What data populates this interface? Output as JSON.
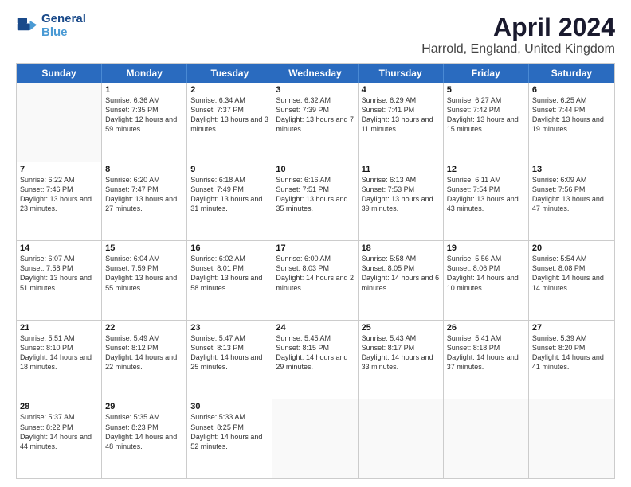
{
  "header": {
    "logo_line1": "General",
    "logo_line2": "Blue",
    "month": "April 2024",
    "location": "Harrold, England, United Kingdom"
  },
  "weekdays": [
    "Sunday",
    "Monday",
    "Tuesday",
    "Wednesday",
    "Thursday",
    "Friday",
    "Saturday"
  ],
  "weeks": [
    [
      {
        "day": "",
        "sunrise": "",
        "sunset": "",
        "daylight": ""
      },
      {
        "day": "1",
        "sunrise": "Sunrise: 6:36 AM",
        "sunset": "Sunset: 7:35 PM",
        "daylight": "Daylight: 12 hours and 59 minutes."
      },
      {
        "day": "2",
        "sunrise": "Sunrise: 6:34 AM",
        "sunset": "Sunset: 7:37 PM",
        "daylight": "Daylight: 13 hours and 3 minutes."
      },
      {
        "day": "3",
        "sunrise": "Sunrise: 6:32 AM",
        "sunset": "Sunset: 7:39 PM",
        "daylight": "Daylight: 13 hours and 7 minutes."
      },
      {
        "day": "4",
        "sunrise": "Sunrise: 6:29 AM",
        "sunset": "Sunset: 7:41 PM",
        "daylight": "Daylight: 13 hours and 11 minutes."
      },
      {
        "day": "5",
        "sunrise": "Sunrise: 6:27 AM",
        "sunset": "Sunset: 7:42 PM",
        "daylight": "Daylight: 13 hours and 15 minutes."
      },
      {
        "day": "6",
        "sunrise": "Sunrise: 6:25 AM",
        "sunset": "Sunset: 7:44 PM",
        "daylight": "Daylight: 13 hours and 19 minutes."
      }
    ],
    [
      {
        "day": "7",
        "sunrise": "Sunrise: 6:22 AM",
        "sunset": "Sunset: 7:46 PM",
        "daylight": "Daylight: 13 hours and 23 minutes."
      },
      {
        "day": "8",
        "sunrise": "Sunrise: 6:20 AM",
        "sunset": "Sunset: 7:47 PM",
        "daylight": "Daylight: 13 hours and 27 minutes."
      },
      {
        "day": "9",
        "sunrise": "Sunrise: 6:18 AM",
        "sunset": "Sunset: 7:49 PM",
        "daylight": "Daylight: 13 hours and 31 minutes."
      },
      {
        "day": "10",
        "sunrise": "Sunrise: 6:16 AM",
        "sunset": "Sunset: 7:51 PM",
        "daylight": "Daylight: 13 hours and 35 minutes."
      },
      {
        "day": "11",
        "sunrise": "Sunrise: 6:13 AM",
        "sunset": "Sunset: 7:53 PM",
        "daylight": "Daylight: 13 hours and 39 minutes."
      },
      {
        "day": "12",
        "sunrise": "Sunrise: 6:11 AM",
        "sunset": "Sunset: 7:54 PM",
        "daylight": "Daylight: 13 hours and 43 minutes."
      },
      {
        "day": "13",
        "sunrise": "Sunrise: 6:09 AM",
        "sunset": "Sunset: 7:56 PM",
        "daylight": "Daylight: 13 hours and 47 minutes."
      }
    ],
    [
      {
        "day": "14",
        "sunrise": "Sunrise: 6:07 AM",
        "sunset": "Sunset: 7:58 PM",
        "daylight": "Daylight: 13 hours and 51 minutes."
      },
      {
        "day": "15",
        "sunrise": "Sunrise: 6:04 AM",
        "sunset": "Sunset: 7:59 PM",
        "daylight": "Daylight: 13 hours and 55 minutes."
      },
      {
        "day": "16",
        "sunrise": "Sunrise: 6:02 AM",
        "sunset": "Sunset: 8:01 PM",
        "daylight": "Daylight: 13 hours and 58 minutes."
      },
      {
        "day": "17",
        "sunrise": "Sunrise: 6:00 AM",
        "sunset": "Sunset: 8:03 PM",
        "daylight": "Daylight: 14 hours and 2 minutes."
      },
      {
        "day": "18",
        "sunrise": "Sunrise: 5:58 AM",
        "sunset": "Sunset: 8:05 PM",
        "daylight": "Daylight: 14 hours and 6 minutes."
      },
      {
        "day": "19",
        "sunrise": "Sunrise: 5:56 AM",
        "sunset": "Sunset: 8:06 PM",
        "daylight": "Daylight: 14 hours and 10 minutes."
      },
      {
        "day": "20",
        "sunrise": "Sunrise: 5:54 AM",
        "sunset": "Sunset: 8:08 PM",
        "daylight": "Daylight: 14 hours and 14 minutes."
      }
    ],
    [
      {
        "day": "21",
        "sunrise": "Sunrise: 5:51 AM",
        "sunset": "Sunset: 8:10 PM",
        "daylight": "Daylight: 14 hours and 18 minutes."
      },
      {
        "day": "22",
        "sunrise": "Sunrise: 5:49 AM",
        "sunset": "Sunset: 8:12 PM",
        "daylight": "Daylight: 14 hours and 22 minutes."
      },
      {
        "day": "23",
        "sunrise": "Sunrise: 5:47 AM",
        "sunset": "Sunset: 8:13 PM",
        "daylight": "Daylight: 14 hours and 25 minutes."
      },
      {
        "day": "24",
        "sunrise": "Sunrise: 5:45 AM",
        "sunset": "Sunset: 8:15 PM",
        "daylight": "Daylight: 14 hours and 29 minutes."
      },
      {
        "day": "25",
        "sunrise": "Sunrise: 5:43 AM",
        "sunset": "Sunset: 8:17 PM",
        "daylight": "Daylight: 14 hours and 33 minutes."
      },
      {
        "day": "26",
        "sunrise": "Sunrise: 5:41 AM",
        "sunset": "Sunset: 8:18 PM",
        "daylight": "Daylight: 14 hours and 37 minutes."
      },
      {
        "day": "27",
        "sunrise": "Sunrise: 5:39 AM",
        "sunset": "Sunset: 8:20 PM",
        "daylight": "Daylight: 14 hours and 41 minutes."
      }
    ],
    [
      {
        "day": "28",
        "sunrise": "Sunrise: 5:37 AM",
        "sunset": "Sunset: 8:22 PM",
        "daylight": "Daylight: 14 hours and 44 minutes."
      },
      {
        "day": "29",
        "sunrise": "Sunrise: 5:35 AM",
        "sunset": "Sunset: 8:23 PM",
        "daylight": "Daylight: 14 hours and 48 minutes."
      },
      {
        "day": "30",
        "sunrise": "Sunrise: 5:33 AM",
        "sunset": "Sunset: 8:25 PM",
        "daylight": "Daylight: 14 hours and 52 minutes."
      },
      {
        "day": "",
        "sunrise": "",
        "sunset": "",
        "daylight": ""
      },
      {
        "day": "",
        "sunrise": "",
        "sunset": "",
        "daylight": ""
      },
      {
        "day": "",
        "sunrise": "",
        "sunset": "",
        "daylight": ""
      },
      {
        "day": "",
        "sunrise": "",
        "sunset": "",
        "daylight": ""
      }
    ]
  ]
}
